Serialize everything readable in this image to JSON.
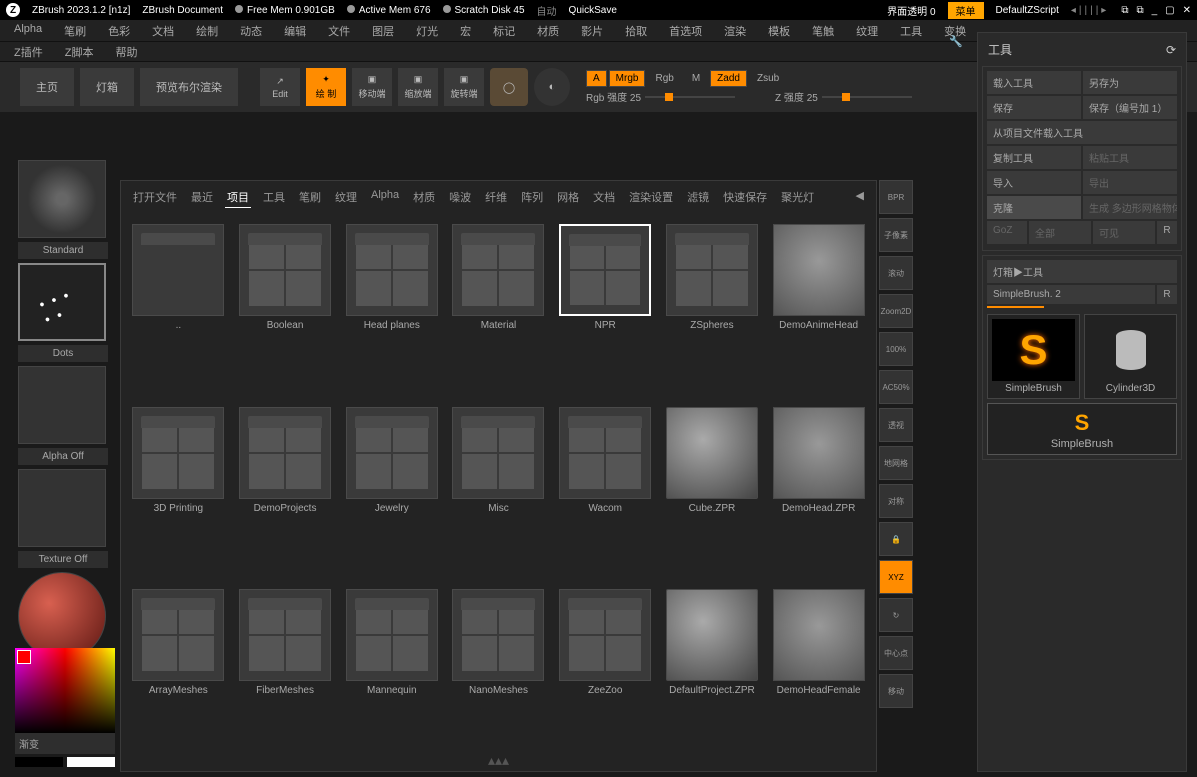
{
  "title": {
    "app": "ZBrush 2023.1.2 [n1z]",
    "doc": "ZBrush Document",
    "freemem": "Free Mem 0.901GB",
    "activemem": "Active Mem 676",
    "scratch": "Scratch Disk 45",
    "auto": "自动",
    "quicksave": "QuickSave",
    "opacity": "界面透明 0",
    "menu": "菜单",
    "script": "DefaultZScript"
  },
  "menu1": [
    "Alpha",
    "笔刷",
    "色彩",
    "文档",
    "绘制",
    "动态",
    "编辑",
    "文件",
    "图层",
    "灯光",
    "宏",
    "标记",
    "材质",
    "影片",
    "拾取",
    "首选项",
    "渲染",
    "模板",
    "笔触",
    "纹理",
    "工具",
    "变换"
  ],
  "menu2": [
    "Z插件",
    "Z脚本",
    "帮助"
  ],
  "toolbar": {
    "home": "主页",
    "lightbox": "灯箱",
    "preview": "预览布尔渲染",
    "edit": "Edit",
    "draw": "绘 制",
    "move": "移动端",
    "scale": "缩放端",
    "rotate": "旋转端",
    "a": "A",
    "mrgb": "Mrgb",
    "rgb": "Rgb",
    "m": "M",
    "zadd": "Zadd",
    "zsub": "Zsub",
    "rgbint": "Rgb 强度 25",
    "zint": "Z 强度 25"
  },
  "left": {
    "brush": "Standard",
    "stroke": "Dots",
    "alpha": "Alpha Off",
    "texture": "Texture Off",
    "material": "MatCap Red Wax",
    "gradient": "渐变"
  },
  "browser": {
    "tabs": [
      "打开文件",
      "最近",
      "项目",
      "工具",
      "笔刷",
      "纹理",
      "Alpha",
      "材质",
      "噪波",
      "纤维",
      "阵列",
      "网格",
      "文档",
      "渲染设置",
      "滤镜",
      "快速保存",
      "聚光灯"
    ],
    "active_tab_index": 2,
    "items": [
      {
        "name": ".."
      },
      {
        "name": "Boolean"
      },
      {
        "name": "Head planes"
      },
      {
        "name": "Material"
      },
      {
        "name": "NPR",
        "hl": true
      },
      {
        "name": "ZSpheres"
      },
      {
        "name": "DemoAnimeHead",
        "head": true
      },
      {
        "name": "3D Printing"
      },
      {
        "name": "DemoProjects"
      },
      {
        "name": "Jewelry"
      },
      {
        "name": "Misc"
      },
      {
        "name": "Wacom"
      },
      {
        "name": "Cube.ZPR",
        "sphere": true
      },
      {
        "name": "DemoHead.ZPR",
        "head": true
      },
      {
        "name": "ArrayMeshes"
      },
      {
        "name": "FiberMeshes"
      },
      {
        "name": "Mannequin"
      },
      {
        "name": "NanoMeshes"
      },
      {
        "name": "ZeeZoo"
      },
      {
        "name": "DefaultProject.ZPR",
        "sphere": true
      },
      {
        "name": "DemoHeadFemale",
        "head": true
      }
    ]
  },
  "rtools": [
    "BPR",
    "子像素",
    "滚动",
    "Zoom2D",
    "100%",
    "AC50%",
    "透视",
    "地网格",
    "对称",
    "🔒",
    "XYZ",
    "↻",
    "中心点",
    "移动"
  ],
  "rtools_active_index": 10,
  "rpanel": {
    "title": "工具",
    "load": "载入工具",
    "saveas": "另存为",
    "save": "保存",
    "saveinc": "保存（编号加 1）",
    "loadproj": "从项目文件载入工具",
    "copy": "复制工具",
    "paste": "粘贴工具",
    "import": "导入",
    "export": "导出",
    "clone": "克隆",
    "makepoly": "生成 多边形网格物体",
    "goz": "GoZ",
    "all": "全部",
    "visible": "可见",
    "r": "R",
    "lightbox_tools": "灯箱▶工具",
    "current": "SimpleBrush. 2",
    "r2": "R",
    "tool1": "SimpleBrush",
    "tool2": "Cylinder3D",
    "subtool": "SimpleBrush"
  }
}
